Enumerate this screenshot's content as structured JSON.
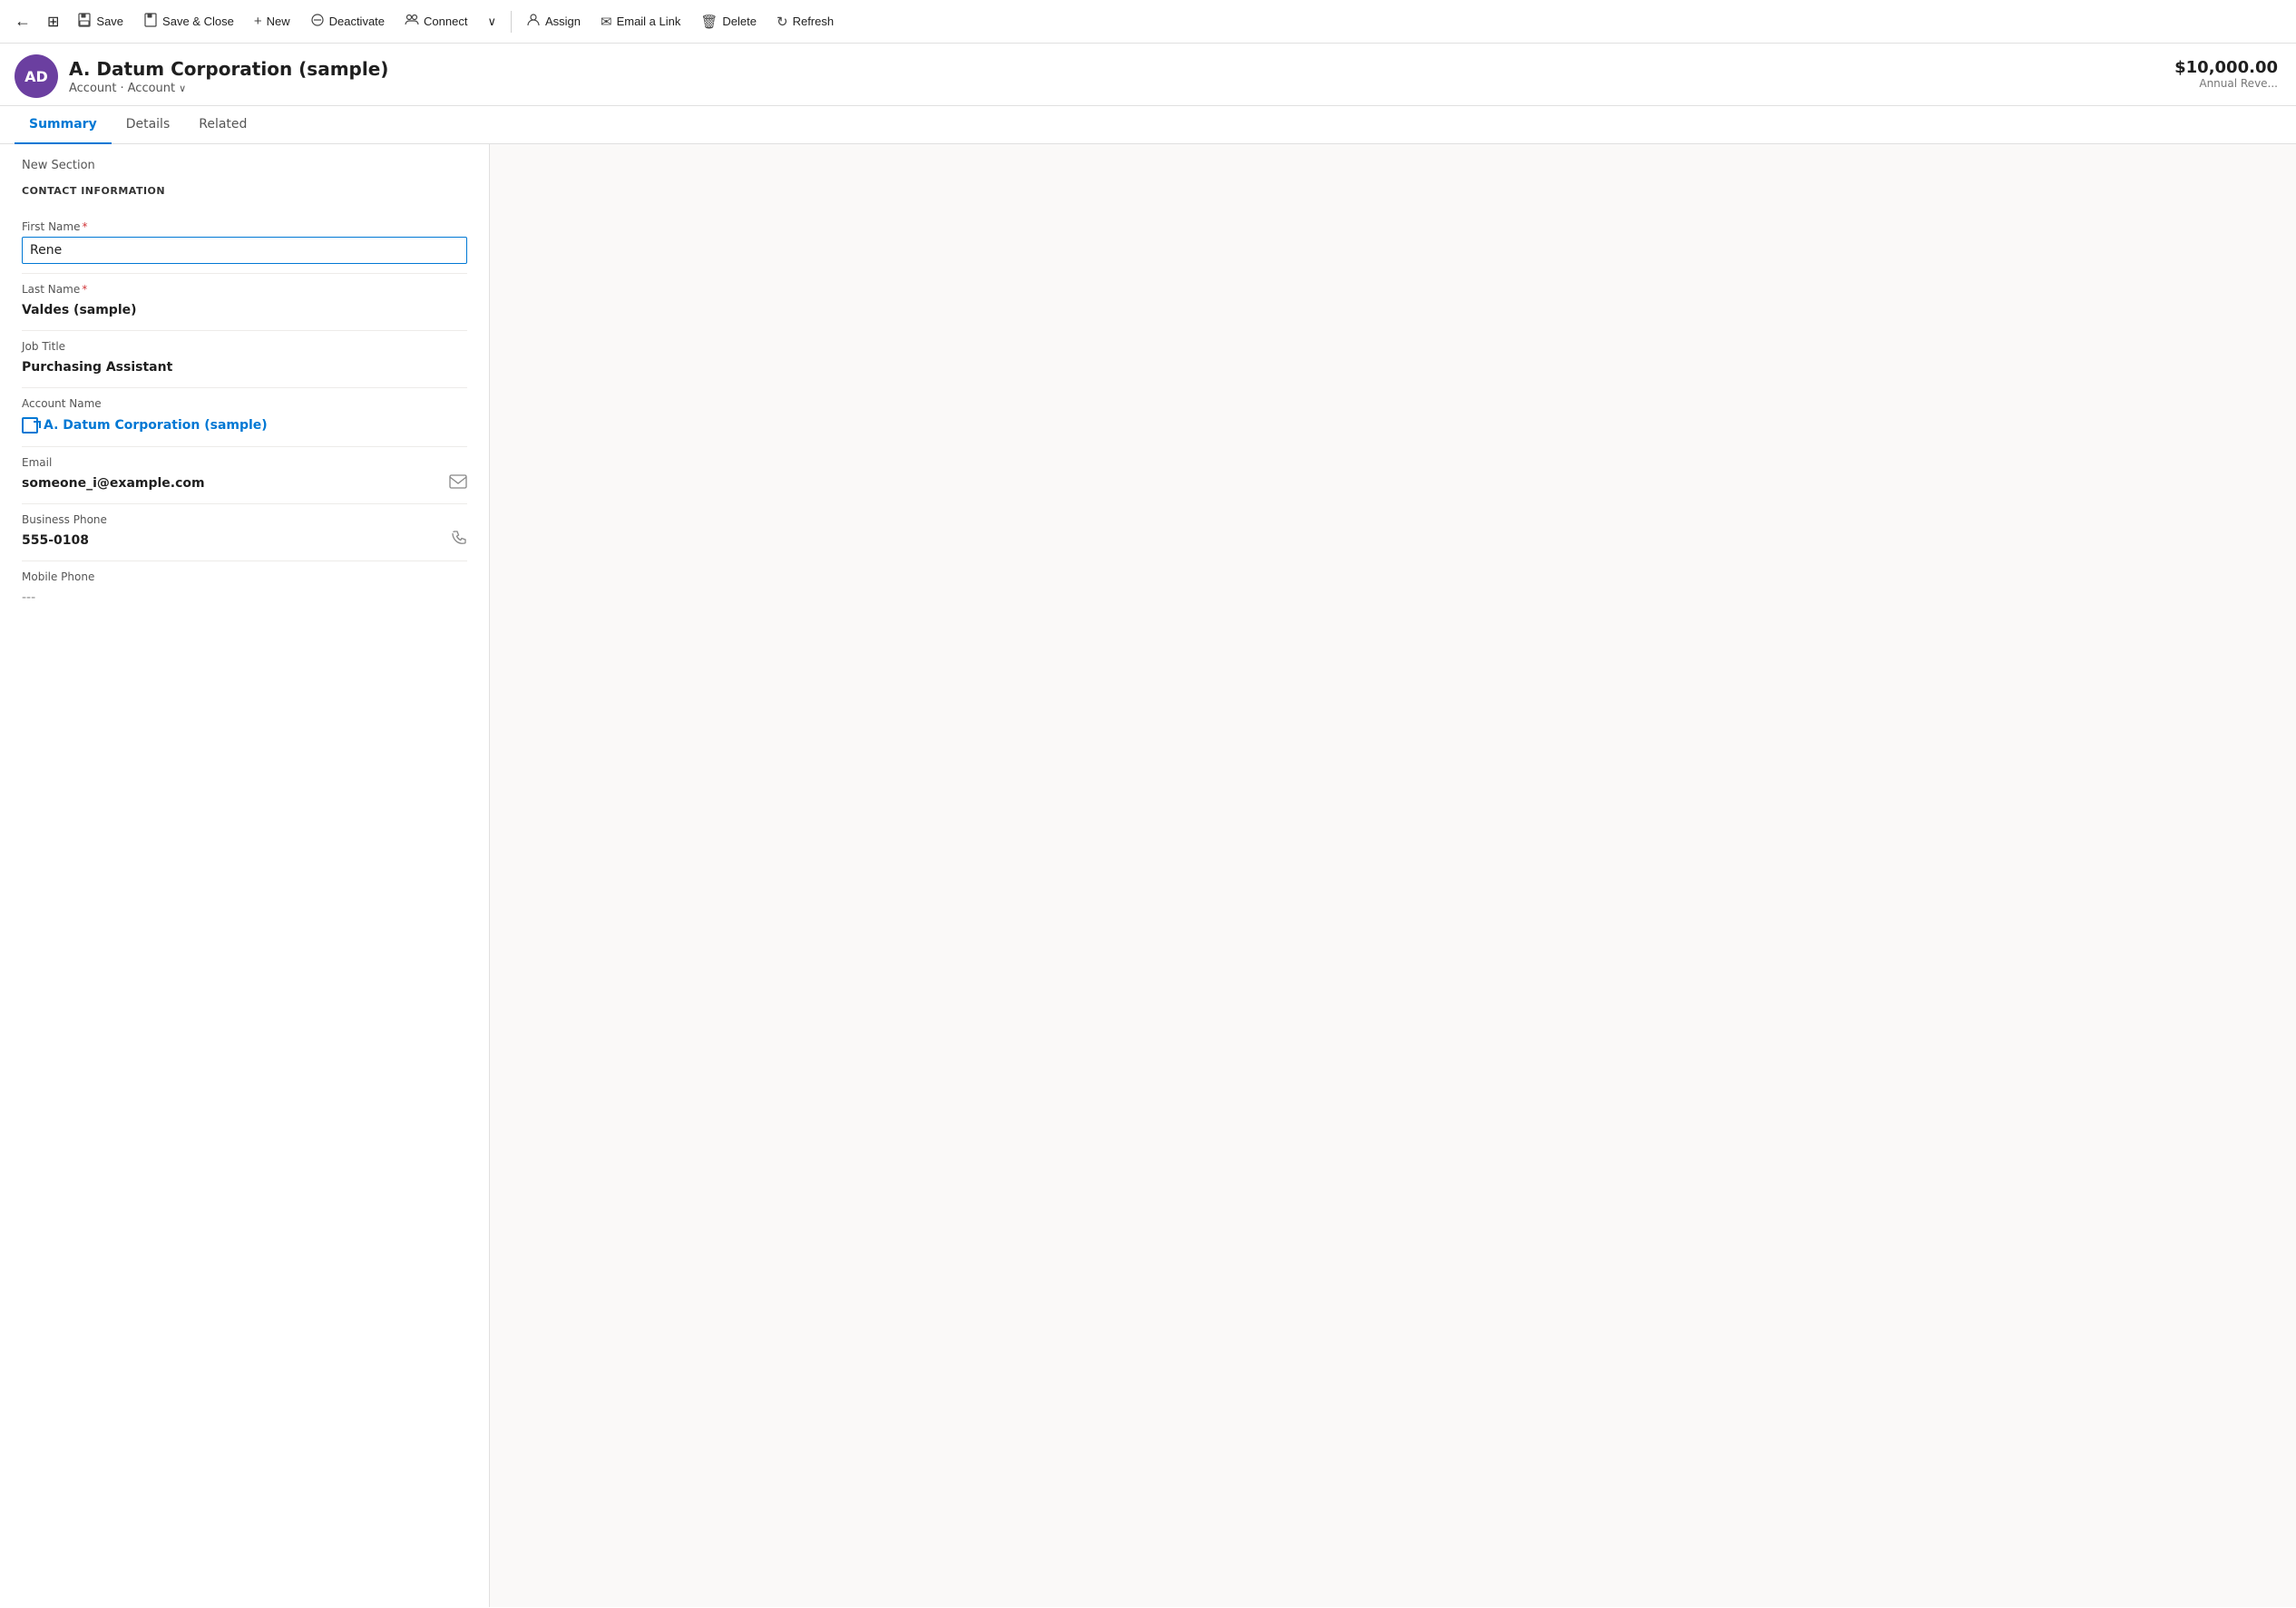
{
  "toolbar": {
    "back_label": "←",
    "nav_icon": "≡",
    "save_label": "Save",
    "save_close_label": "Save & Close",
    "new_label": "New",
    "deactivate_label": "Deactivate",
    "connect_label": "Connect",
    "more_label": "∨",
    "assign_label": "Assign",
    "email_link_label": "Email a Link",
    "delete_label": "Delete",
    "refresh_label": "Refresh"
  },
  "record": {
    "avatar_initials": "AD",
    "avatar_bg": "#6b3fa0",
    "title": "A. Datum Corporation (sample)",
    "breadcrumb1": "Account",
    "breadcrumb2": "Account",
    "annual_revenue": "$10,000.00",
    "annual_revenue_label": "Annual Reve..."
  },
  "tabs": [
    {
      "id": "summary",
      "label": "Summary",
      "active": true
    },
    {
      "id": "details",
      "label": "Details",
      "active": false
    },
    {
      "id": "related",
      "label": "Related",
      "active": false
    }
  ],
  "form": {
    "section_title": "New Section",
    "contact_info_title": "CONTACT INFORMATION",
    "fields": [
      {
        "id": "first_name",
        "label": "First Name",
        "required": true,
        "type": "input",
        "value": "Rene"
      },
      {
        "id": "last_name",
        "label": "Last Name",
        "required": true,
        "type": "value",
        "value": "Valdes (sample)"
      },
      {
        "id": "job_title",
        "label": "Job Title",
        "required": false,
        "type": "value",
        "value": "Purchasing Assistant"
      },
      {
        "id": "account_name",
        "label": "Account Name",
        "required": false,
        "type": "link",
        "value": "A. Datum Corporation (sample)"
      },
      {
        "id": "email",
        "label": "Email",
        "required": false,
        "type": "value_icon",
        "value": "someone_i@example.com",
        "icon": "email"
      },
      {
        "id": "business_phone",
        "label": "Business Phone",
        "required": false,
        "type": "value_icon",
        "value": "555-0108",
        "icon": "phone"
      },
      {
        "id": "mobile_phone",
        "label": "Mobile Phone",
        "required": false,
        "type": "null",
        "value": "---"
      }
    ]
  },
  "icons": {
    "back": "←",
    "nav": "⊞",
    "save": "💾",
    "save_close": "💾",
    "new": "+",
    "deactivate": "⊘",
    "connect": "👥",
    "more": "›",
    "assign": "👤",
    "email_link": "✉",
    "delete": "🗑",
    "refresh": "↻",
    "email_action": "✉",
    "phone_action": "☎"
  }
}
